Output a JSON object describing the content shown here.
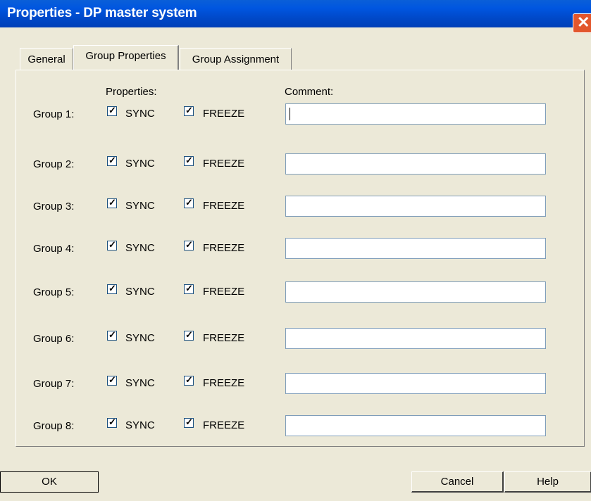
{
  "window": {
    "title": "Properties - DP master system",
    "close_glyph": "✕"
  },
  "tabs": [
    {
      "label": "General",
      "active": false
    },
    {
      "label": "Group Properties",
      "active": true
    },
    {
      "label": "Group Assignment",
      "active": false
    }
  ],
  "headers": {
    "properties": "Properties:",
    "comment": "Comment:"
  },
  "groups": [
    {
      "label": "Group 1:",
      "sync": "SYNC",
      "freeze": "FREEZE",
      "sync_checked": true,
      "freeze_checked": true,
      "comment": ""
    },
    {
      "label": "Group 2:",
      "sync": "SYNC",
      "freeze": "FREEZE",
      "sync_checked": true,
      "freeze_checked": true,
      "comment": ""
    },
    {
      "label": "Group 3:",
      "sync": "SYNC",
      "freeze": "FREEZE",
      "sync_checked": true,
      "freeze_checked": true,
      "comment": ""
    },
    {
      "label": "Group 4:",
      "sync": "SYNC",
      "freeze": "FREEZE",
      "sync_checked": true,
      "freeze_checked": true,
      "comment": ""
    },
    {
      "label": "Group 5:",
      "sync": "SYNC",
      "freeze": "FREEZE",
      "sync_checked": true,
      "freeze_checked": true,
      "comment": ""
    },
    {
      "label": "Group 6:",
      "sync": "SYNC",
      "freeze": "FREEZE",
      "sync_checked": true,
      "freeze_checked": true,
      "comment": ""
    },
    {
      "label": "Group 7:",
      "sync": "SYNC",
      "freeze": "FREEZE",
      "sync_checked": true,
      "freeze_checked": true,
      "comment": ""
    },
    {
      "label": "Group 8:",
      "sync": "SYNC",
      "freeze": "FREEZE",
      "sync_checked": true,
      "freeze_checked": true,
      "comment": ""
    }
  ],
  "buttons": {
    "ok": "OK",
    "cancel": "Cancel",
    "help": "Help"
  },
  "colors": {
    "titlebar": "#0054e3",
    "dialog_bg": "#ece9d8",
    "close_button": "#e2562c"
  }
}
